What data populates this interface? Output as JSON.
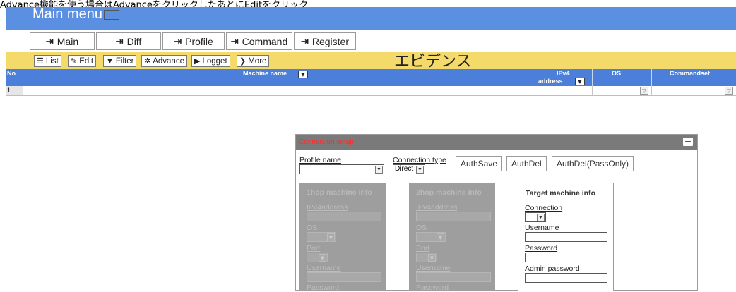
{
  "note": {
    "text": "Advance機能を使う場合はAdvanceをクリックしたあとにEditをクリック"
  },
  "header": {
    "title": "Main menu"
  },
  "nav_tabs": [
    {
      "label": "Main"
    },
    {
      "label": "Diff"
    },
    {
      "label": "Profile"
    },
    {
      "label": "Command"
    },
    {
      "label": "Register"
    }
  ],
  "toolbar": {
    "buttons": [
      {
        "label": "List",
        "icon": "list-icon"
      },
      {
        "label": "Edit",
        "icon": "edit-icon"
      },
      {
        "label": "Filter",
        "icon": "filter-icon"
      },
      {
        "label": "Advance",
        "icon": "gear-icon"
      },
      {
        "label": "Logget",
        "icon": "play-icon"
      },
      {
        "label": "More",
        "icon": "chevron-right-icon"
      }
    ],
    "page_heading": "エビデンス"
  },
  "table": {
    "columns": {
      "no": "No",
      "machine_name": "Machine name",
      "ipv4_line1": "IPv4",
      "ipv4_line2": "address",
      "os": "OS",
      "commandset": "Commandset"
    },
    "rows": [
      {
        "no": "1"
      }
    ]
  },
  "dialog": {
    "title": "Connection setup",
    "profile_label": "Profile name",
    "connection_type_label": "Connection type",
    "connection_type_value": "Direct",
    "buttons": {
      "auth_save": "AuthSave",
      "auth_del": "AuthDel",
      "auth_del_pass": "AuthDel(PassOnly)"
    },
    "hop1": {
      "title": "1hop machine info",
      "ipv4": "IPv4address",
      "os": "OS",
      "port": "Port",
      "username": "Username",
      "password": "Password"
    },
    "hop2": {
      "title": "2hop machine info",
      "ipv4": "IPv4address",
      "os": "OS",
      "port": "Port",
      "username": "Username",
      "password": "Password"
    },
    "target": {
      "title": "Target machine info",
      "connection": "Connection",
      "username": "Username",
      "password": "Password",
      "admin_password": "Admin password"
    }
  },
  "colors": {
    "header_blue": "#5b8fe2",
    "table_header_blue": "#4b7fd9",
    "toolbar_yellow": "#f4d96b",
    "dialog_title_red": "#ff2a2a",
    "disabled_gray": "#9e9e9e"
  }
}
